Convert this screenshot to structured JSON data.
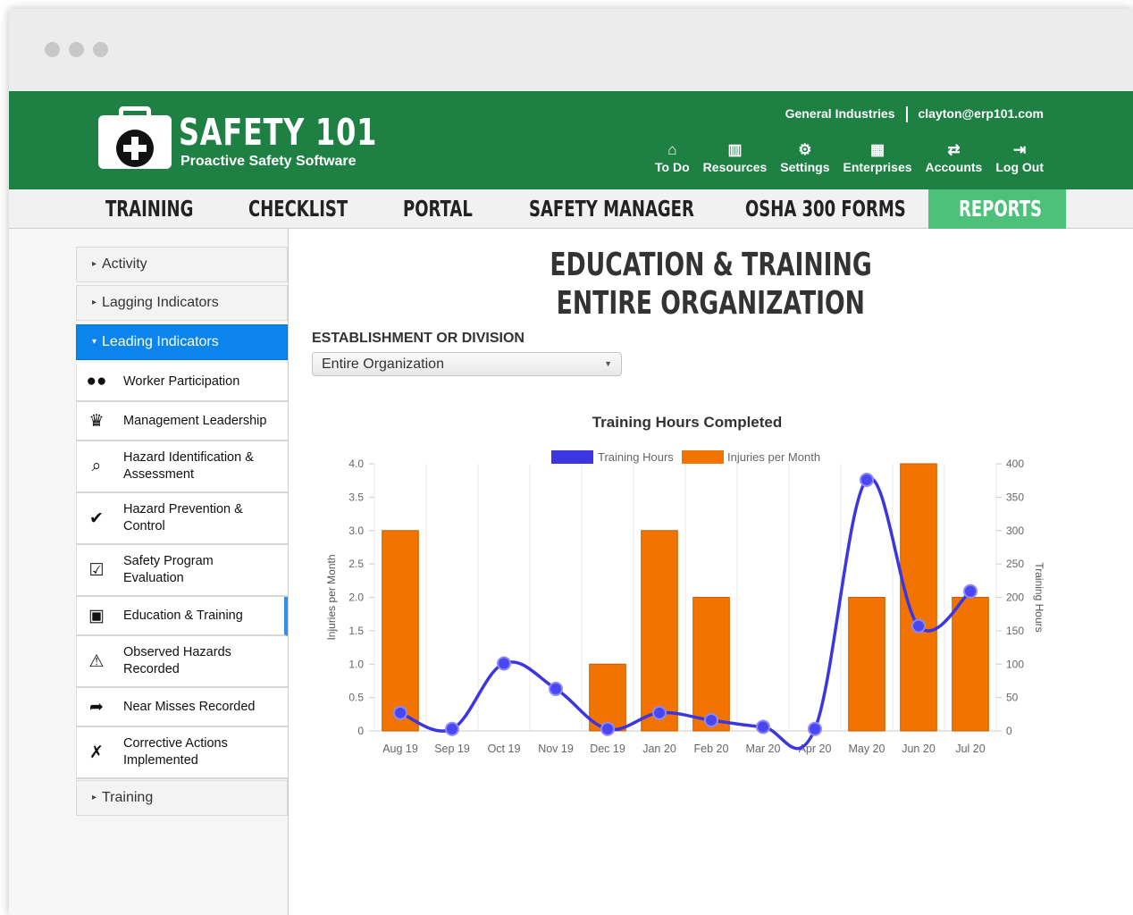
{
  "header": {
    "brand_title": "SAFETY 101",
    "brand_subtitle": "Proactive Safety Software",
    "organization": "General Industries",
    "user_email": "clayton@erp101.com",
    "links": [
      {
        "label": "To Do",
        "icon": "home-icon",
        "glyph": "⌂"
      },
      {
        "label": "Resources",
        "icon": "book-icon",
        "glyph": "▥"
      },
      {
        "label": "Settings",
        "icon": "gear-icon",
        "glyph": "⚙"
      },
      {
        "label": "Enterprises",
        "icon": "building-icon",
        "glyph": "▦"
      },
      {
        "label": "Accounts",
        "icon": "transfer-icon",
        "glyph": "⇄"
      },
      {
        "label": "Log Out",
        "icon": "logout-icon",
        "glyph": "⇥"
      }
    ]
  },
  "nav": {
    "items": [
      "TRAINING",
      "CHECKLIST",
      "PORTAL",
      "SAFETY MANAGER",
      "OSHA 300 FORMS",
      "REPORTS"
    ],
    "active": "REPORTS"
  },
  "sidebar": {
    "groups": [
      {
        "label": "Activity",
        "caret": "▸"
      },
      {
        "label": "Lagging Indicators",
        "caret": "▸"
      },
      {
        "label": "Leading Indicators",
        "caret": "▾"
      },
      {
        "label": "Training",
        "caret": "▸"
      }
    ],
    "items": [
      {
        "label": "Worker Participation",
        "icon": "group-icon",
        "glyph": "👥"
      },
      {
        "label": "Management Leadership",
        "icon": "leader-icon",
        "glyph": "👔"
      },
      {
        "label": "Hazard Identification &\nAssessment",
        "icon": "magnifier-hazard-icon",
        "glyph": "⌕"
      },
      {
        "label": "Hazard Prevention &\nControl",
        "icon": "check-circle-icon",
        "glyph": "✓"
      },
      {
        "label": "Safety Program\nEvaluation",
        "icon": "clipboard-check-icon",
        "glyph": "☑"
      },
      {
        "label": "Education & Training",
        "icon": "presentation-icon",
        "glyph": "▣"
      },
      {
        "label": "Observed Hazards\nRecorded",
        "icon": "warning-icon",
        "glyph": "⚠"
      },
      {
        "label": "Near Misses Recorded",
        "icon": "falling-person-icon",
        "glyph": "🏃"
      },
      {
        "label": "Corrective Actions\nImplemented",
        "icon": "tools-icon",
        "glyph": "✗"
      }
    ],
    "selected": "Education & Training"
  },
  "main": {
    "title_line1": "EDUCATION & TRAINING",
    "title_line2": "ENTIRE ORGANIZATION",
    "field_label": "ESTABLISHMENT OR DIVISION",
    "select_value": "Entire Organization"
  },
  "colors": {
    "header_green": "#1e8043",
    "active_tab": "#4dc079",
    "sidebar_active": "#0b84ee",
    "series_line": "#3b36e0",
    "series_bar": "#f27300"
  },
  "chart_data": {
    "type": "bar+line",
    "title": "Training Hours Completed",
    "categories": [
      "Aug 19",
      "Sep 19",
      "Oct 19",
      "Nov 19",
      "Dec 19",
      "Jan 20",
      "Feb 20",
      "Mar 20",
      "Apr 20",
      "May 20",
      "Jun 20",
      "Jul 20"
    ],
    "series": [
      {
        "name": "Training Hours",
        "type": "line",
        "axis": "right",
        "color": "#3b36e0",
        "values": [
          27,
          3,
          101,
          63,
          3,
          27,
          16,
          6,
          3,
          376,
          157,
          209
        ]
      },
      {
        "name": "Injuries per Month",
        "type": "bar",
        "axis": "left",
        "color": "#f27300",
        "values": [
          3,
          0,
          0,
          0,
          1,
          3,
          2,
          0,
          0,
          2,
          4,
          2
        ]
      }
    ],
    "ylabel_left": "Injuries per Month",
    "ylabel_right": "Training Hours",
    "ylim_left": [
      0,
      4
    ],
    "ylim_right": [
      0,
      400
    ],
    "yticks_left": [
      "0",
      "0.5",
      "1.0",
      "1.5",
      "2.0",
      "2.5",
      "3.0",
      "3.5",
      "4.0"
    ],
    "yticks_right": [
      "0",
      "50",
      "100",
      "150",
      "200",
      "250",
      "300",
      "350",
      "400"
    ],
    "grid": "vertical",
    "legend_position": "top"
  }
}
